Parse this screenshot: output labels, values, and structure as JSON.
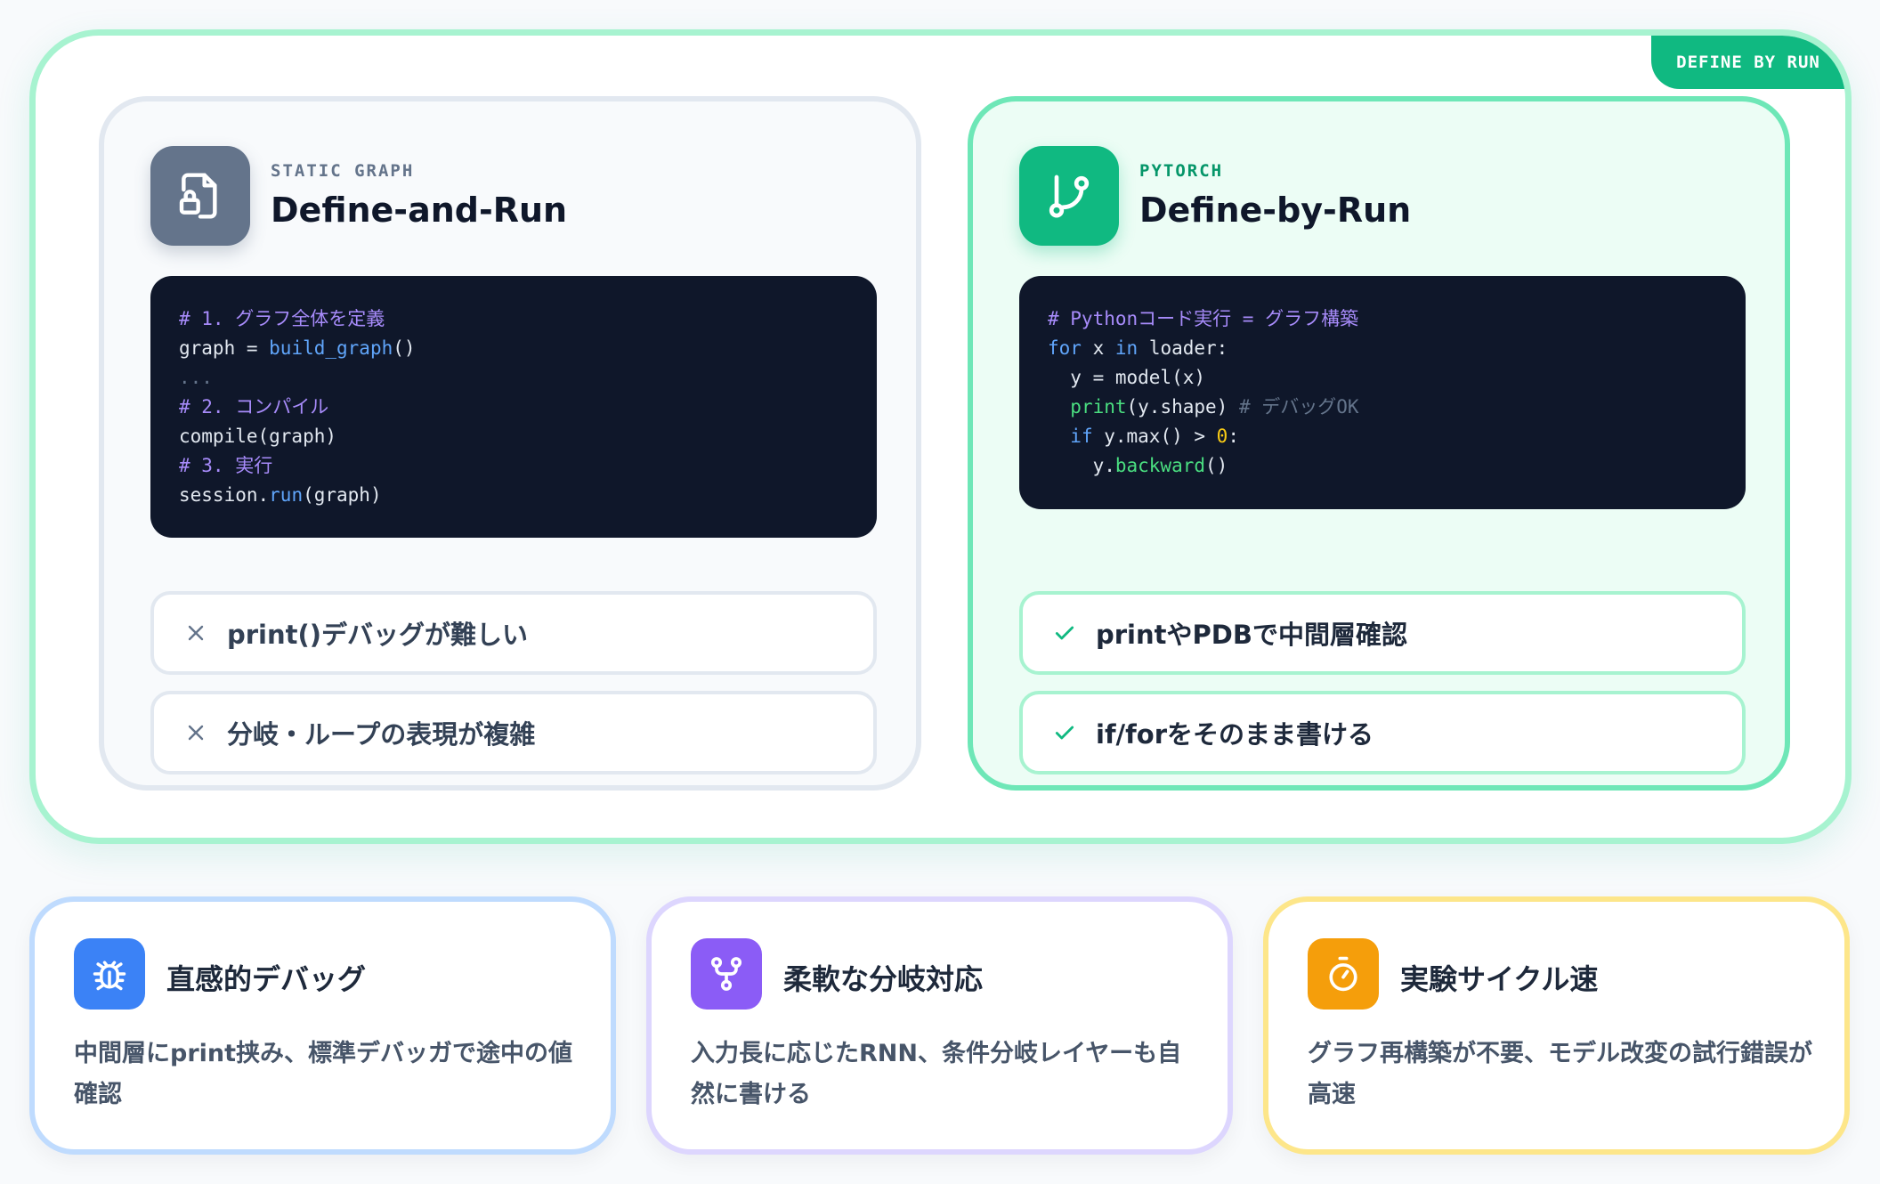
{
  "badge": "DEFINE BY RUN",
  "static_card": {
    "kicker": "STATIC GRAPH",
    "title": "Define-and-Run",
    "icon": "file-lock-icon",
    "code": {
      "l1": "# 1. グラフ全体を定義",
      "l2_a": "graph = ",
      "l2_b": "build_graph",
      "l2_c": "()",
      "l3": "...",
      "l4": "# 2. コンパイル",
      "l5": "compile(graph)",
      "l6": "# 3. 実行",
      "l7_a": "session.",
      "l7_b": "run",
      "l7_c": "(graph)"
    },
    "points": [
      "print()デバッグが難しい",
      "分岐・ループの表現が複雑"
    ],
    "point_icon": "x-icon"
  },
  "dynamic_card": {
    "kicker": "PYTORCH",
    "title": "Define-by-Run",
    "icon": "git-branch-icon",
    "code": {
      "l1": "# Pythonコード実行 = グラフ構築",
      "l2_a": "for",
      "l2_b": " x ",
      "l2_c": "in",
      "l2_d": " loader:",
      "l3": "  y = model(x)",
      "l4_a": "  ",
      "l4_b": "print",
      "l4_c": "(y.shape) ",
      "l4_d": "# デバッグOK",
      "l5_a": "  ",
      "l5_b": "if",
      "l5_c": " y.max() > ",
      "l5_d": "0",
      "l5_e": ":",
      "l6_a": "    y.",
      "l6_b": "backward",
      "l6_c": "()"
    },
    "points": [
      "printやPDBで中間層確認",
      "if/forをそのまま書ける"
    ],
    "point_icon": "check-icon"
  },
  "features": [
    {
      "title": "直感的デバッグ",
      "desc": "中間層にprint挟み、標準デバッガで途中の値確認",
      "icon": "bug-icon",
      "color": "#3b82f6"
    },
    {
      "title": "柔軟な分岐対応",
      "desc": "入力長に応じたRNN、条件分岐レイヤーも自然に書ける",
      "icon": "branch-fork-icon",
      "color": "#8b5cf6"
    },
    {
      "title": "実験サイクル速",
      "desc": "グラフ再構築が不要、モデル改変の試行錯誤が高速",
      "icon": "stopwatch-icon",
      "color": "#f59e0b"
    }
  ]
}
